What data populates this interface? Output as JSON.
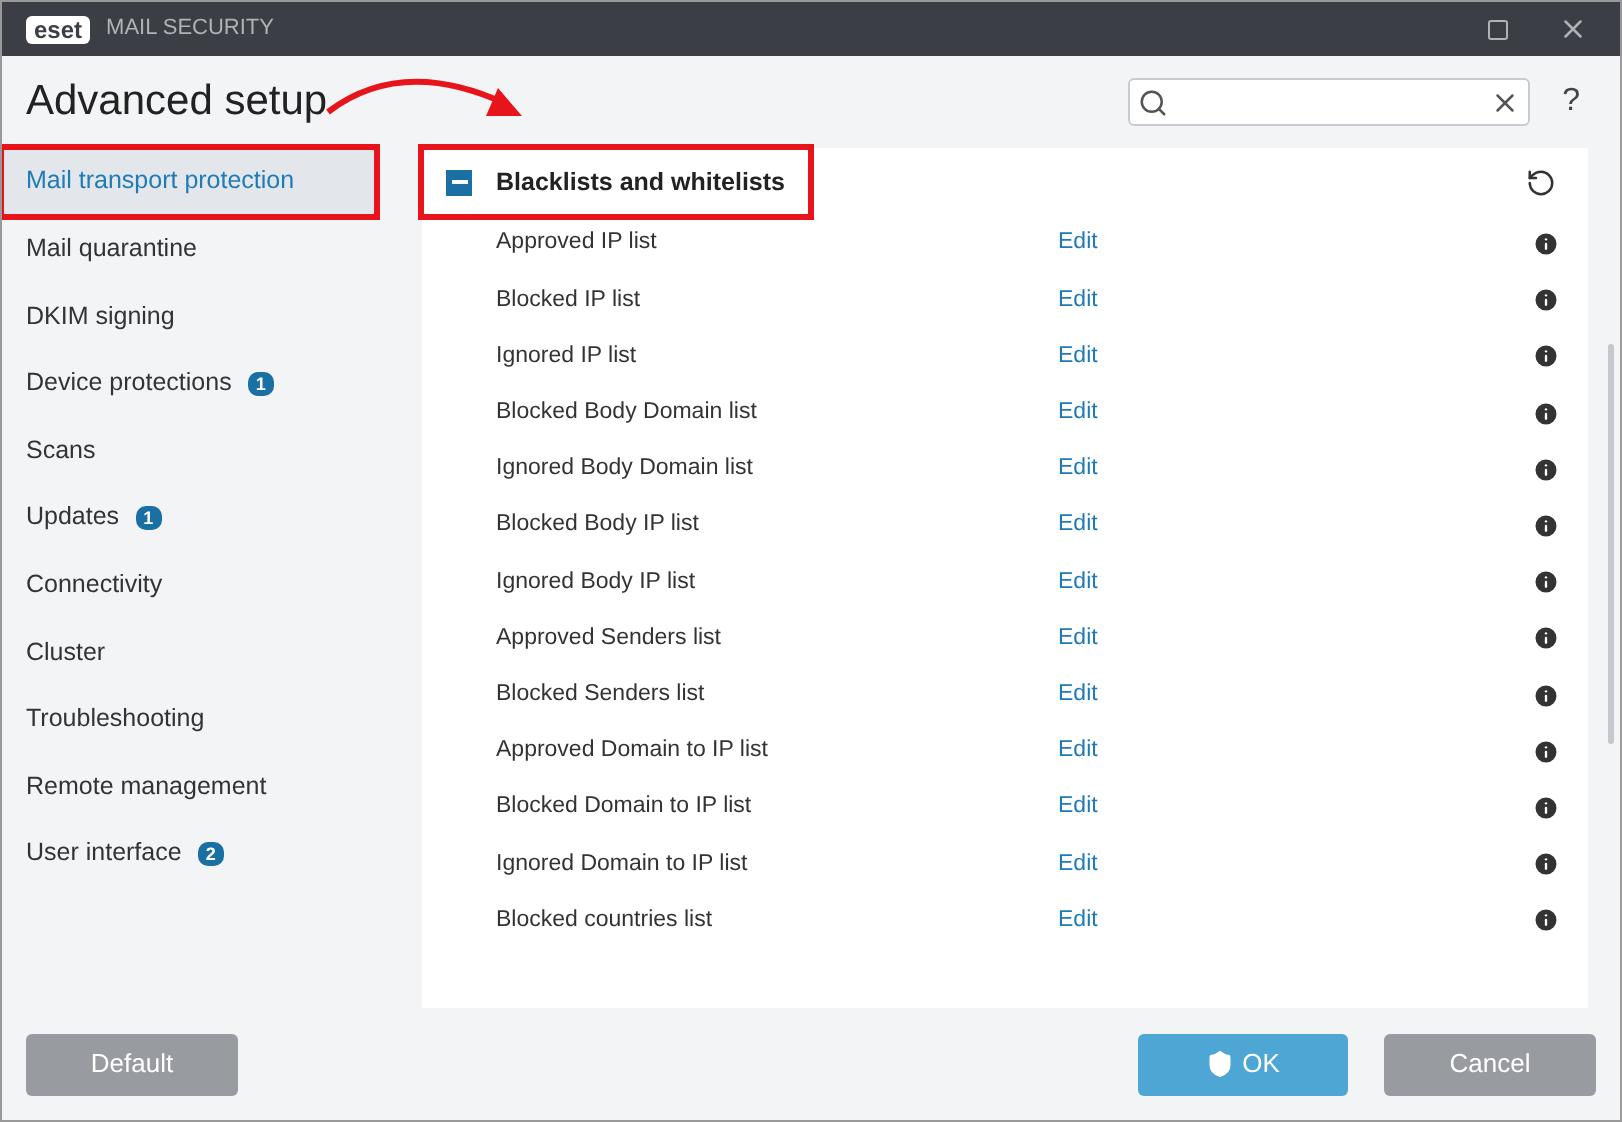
{
  "window": {
    "logo": "eset",
    "title": "MAIL SECURITY"
  },
  "header": {
    "title": "Advanced setup",
    "help": "?"
  },
  "sidebar": {
    "items": [
      {
        "label": "Mail transport protection",
        "selected": true,
        "highlighted": true
      },
      {
        "label": "Mail quarantine",
        "selected": false,
        "highlighted": false
      },
      {
        "label": "DKIM signing",
        "selected": false,
        "highlighted": false
      },
      {
        "label": "Device protections",
        "selected": false,
        "highlighted": false,
        "badge": "1"
      },
      {
        "label": "Scans",
        "selected": false,
        "highlighted": false
      },
      {
        "label": "Updates",
        "selected": false,
        "highlighted": false,
        "badge": "1"
      },
      {
        "label": "Connectivity",
        "selected": false,
        "highlighted": false
      },
      {
        "label": "Cluster",
        "selected": false,
        "highlighted": false
      },
      {
        "label": "Troubleshooting",
        "selected": false,
        "highlighted": false
      },
      {
        "label": "Remote management",
        "selected": false,
        "highlighted": false
      },
      {
        "label": "User interface",
        "selected": false,
        "highlighted": false,
        "badge": "2"
      }
    ]
  },
  "section": {
    "title": "Blacklists and whitelists",
    "expanded": true,
    "highlighted": true,
    "rows": [
      {
        "label": "Approved IP list",
        "action": "Edit"
      },
      {
        "label": "Blocked IP list",
        "action": "Edit"
      },
      {
        "label": "Ignored IP list",
        "action": "Edit"
      },
      {
        "label": "Blocked Body Domain list",
        "action": "Edit"
      },
      {
        "label": "Ignored Body Domain list",
        "action": "Edit"
      },
      {
        "label": "Blocked Body IP list",
        "action": "Edit"
      },
      {
        "label": "Ignored Body IP list",
        "action": "Edit"
      },
      {
        "label": "Approved Senders list",
        "action": "Edit"
      },
      {
        "label": "Blocked Senders list",
        "action": "Edit"
      },
      {
        "label": "Approved Domain to IP list",
        "action": "Edit"
      },
      {
        "label": "Blocked Domain to IP list",
        "action": "Edit"
      },
      {
        "label": "Ignored Domain to IP list",
        "action": "Edit"
      },
      {
        "label": "Blocked countries list",
        "action": "Edit"
      }
    ]
  },
  "footer": {
    "default": "Default",
    "ok": "OK",
    "cancel": "Cancel"
  }
}
